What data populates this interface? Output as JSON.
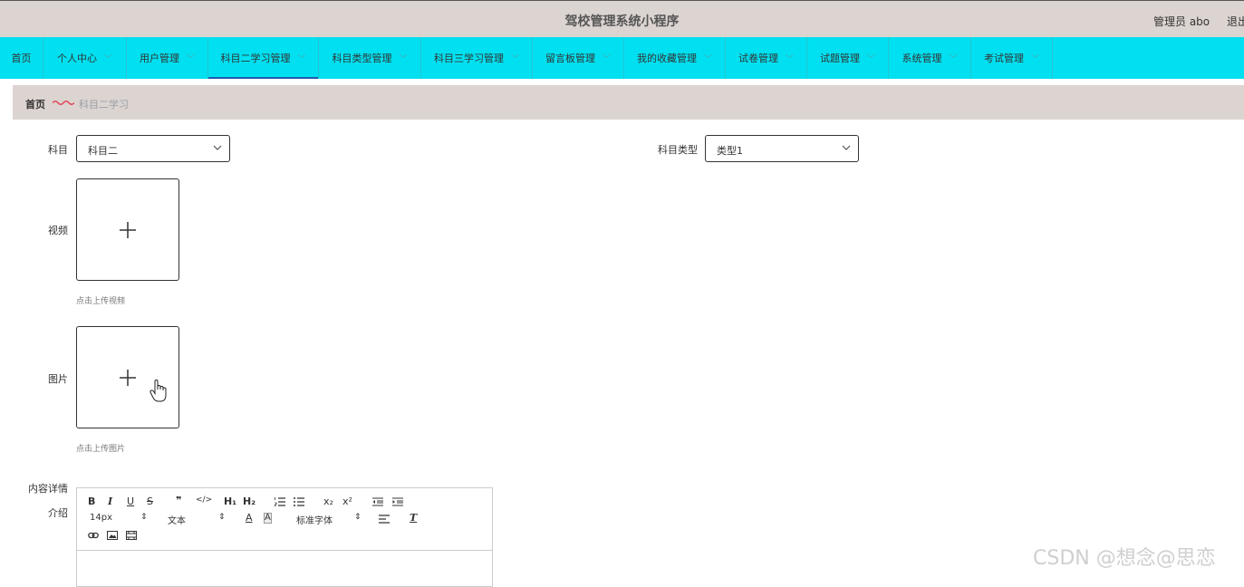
{
  "header": {
    "title": "驾校管理系统小程序",
    "user": "管理员 abo",
    "logout": "退出"
  },
  "nav": [
    {
      "label": "首页"
    },
    {
      "label": "个人中心"
    },
    {
      "label": "用户管理"
    },
    {
      "label": "科目二学习管理"
    },
    {
      "label": "科目类型管理"
    },
    {
      "label": "科目三学习管理"
    },
    {
      "label": "留言板管理"
    },
    {
      "label": "我的收藏管理"
    },
    {
      "label": "试卷管理"
    },
    {
      "label": "试题管理"
    },
    {
      "label": "系统管理"
    },
    {
      "label": "考试管理"
    }
  ],
  "breadcrumb": {
    "home": "首页",
    "current": "科目二学习"
  },
  "form": {
    "subject_label": "科目",
    "subject_value": "科目二",
    "type_label": "科目类型",
    "type_value": "类型1",
    "video_label": "视频",
    "video_hint": "点击上传视频",
    "image_label": "图片",
    "image_hint": "点击上传图片",
    "content_label_1": "内容详情",
    "content_label_2": "介绍"
  },
  "editor": {
    "font_size": "14px",
    "paragraph": "文本",
    "font_family": "标准字体",
    "h1": "H₁",
    "h2": "H₂",
    "sub": "x₂",
    "sup": "x²"
  },
  "watermark": "CSDN @想念@思恋",
  "colors": {
    "nav_bg": "#00e0f0",
    "header_bg": "#dcd4d1",
    "active_underline": "#1a5bab"
  }
}
